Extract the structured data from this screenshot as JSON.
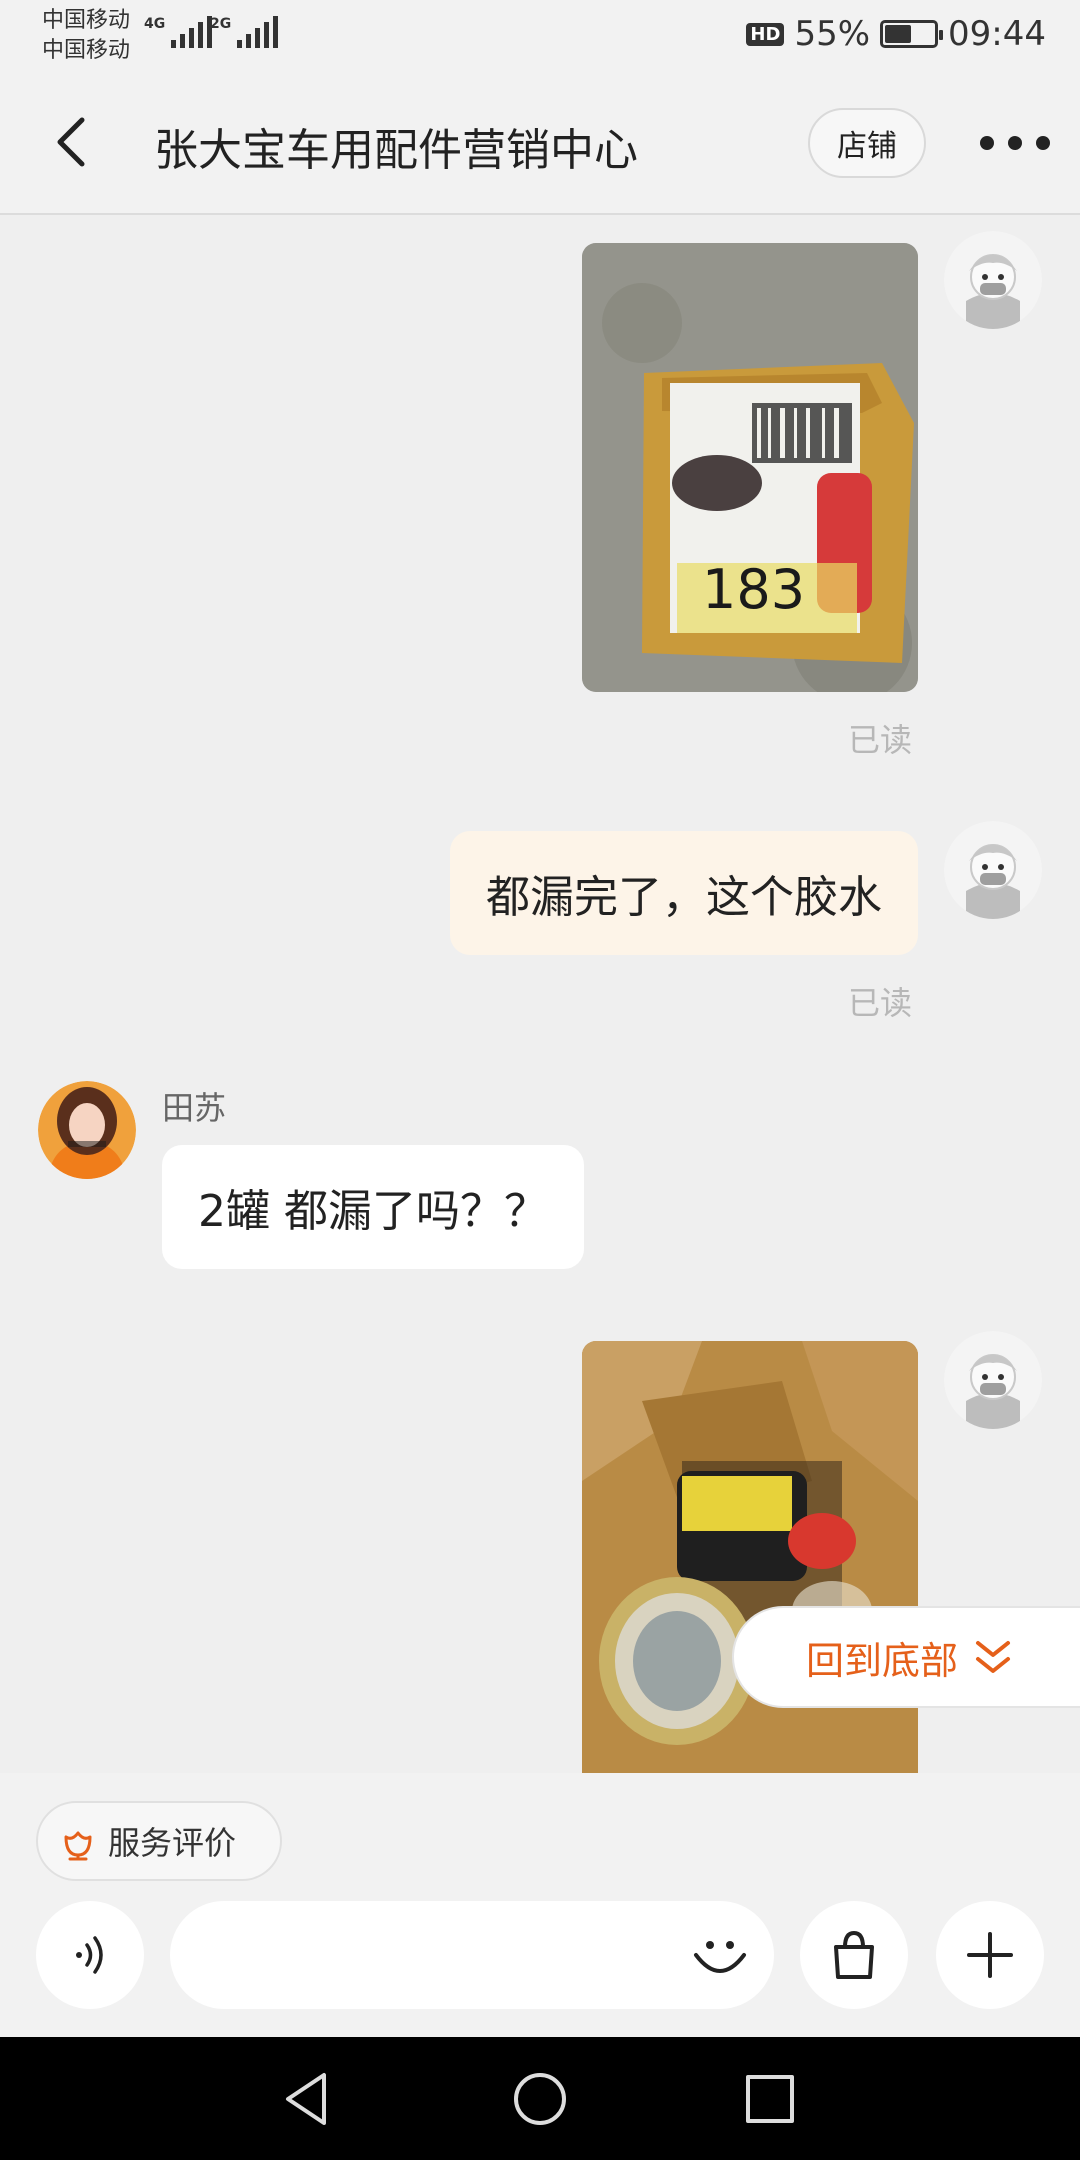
{
  "status_bar": {
    "carrier1": "中国移动",
    "carrier2": "中国移动",
    "net1": "4G",
    "net2": "2G",
    "hd": "HD",
    "battery_text": "55%",
    "battery_level": 0.55,
    "time": "09:44"
  },
  "header": {
    "back_icon": "chevron-left-icon",
    "title": "张大宝车用配件营销中心",
    "shop_label": "店铺",
    "more_icon": "more-dots-icon"
  },
  "messages": {
    "m1": {
      "type": "image",
      "from": "me",
      "content": "photo of damaged parcel with shipping label",
      "label_text": "183",
      "read": "已读"
    },
    "m2": {
      "type": "text",
      "from": "me",
      "text": "都漏完了，这个胶水",
      "read": "已读"
    },
    "m3": {
      "type": "text",
      "from": "seller",
      "sender": "田苏",
      "text": "2罐  都漏了吗？？"
    },
    "m4": {
      "type": "image",
      "from": "me",
      "content": "photo of opened box with leaking cans"
    }
  },
  "scroll_to_bottom": {
    "label": "回到底部",
    "icon": "double-chevron-down-icon"
  },
  "bottom_bar": {
    "service_label": "服务评价",
    "service_icon": "flower-icon",
    "voice_icon": "voice-icon",
    "input_placeholder": "",
    "emoji_icon": "smile-icon",
    "bag_icon": "shopping-bag-icon",
    "plus_icon": "plus-icon"
  },
  "colors": {
    "accent": "#e5601a",
    "my_bubble": "#fdf4e8",
    "their_bubble": "#ffffff",
    "background": "#efefef"
  }
}
